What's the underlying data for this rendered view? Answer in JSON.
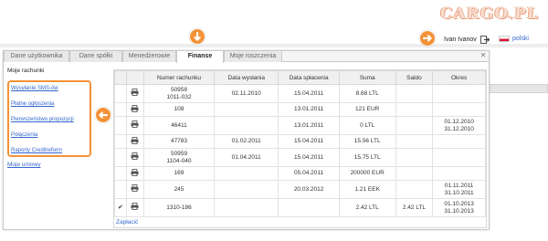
{
  "logo": {
    "text": "CARGO.PL"
  },
  "user": {
    "name": "Ivan Ivanov",
    "logout_icon": "logout-icon"
  },
  "lang": {
    "label": "polski"
  },
  "tabs": [
    {
      "label": "Dane użytkownika",
      "active": false
    },
    {
      "label": "Dane spółki",
      "active": false
    },
    {
      "label": "Menedżerowie",
      "active": false
    },
    {
      "label": "Finanse",
      "active": true
    },
    {
      "label": "Moje roszczenia",
      "active": false
    }
  ],
  "sidebar": {
    "heading": "Moje rachunki",
    "links": [
      {
        "label": "Wysyłanie SMS-ów"
      },
      {
        "label": "Płatne ogłoszenia"
      },
      {
        "label": "Pierwszeństwo propozycji"
      },
      {
        "label": "Połączenia"
      },
      {
        "label": "Raporty Creditreform"
      }
    ],
    "footer": "Moje umowy"
  },
  "table": {
    "columns": [
      "",
      "",
      "Numer rachunku",
      "Data wysłania",
      "Data spłacenia",
      "Suma",
      "Saldo",
      "Okres"
    ],
    "rows": [
      {
        "checked": false,
        "number": "50958",
        "number_sub": "1011-032",
        "sent": "02.11.2010",
        "paid": "15.04.2011",
        "sum": "8.68 LTL",
        "balance": "",
        "period": "",
        "period_sub": ""
      },
      {
        "checked": false,
        "number": "108",
        "number_sub": "",
        "sent": "",
        "paid": "13.01.2011",
        "sum": "121 EUR",
        "balance": "",
        "period": "",
        "period_sub": ""
      },
      {
        "checked": false,
        "number": "46411",
        "number_sub": "",
        "sent": "",
        "paid": "13.01.2011",
        "sum": "0 LTL",
        "balance": "",
        "period": "01.12.2010",
        "period_sub": "31.12.2010"
      },
      {
        "checked": false,
        "number": "47783",
        "number_sub": "",
        "sent": "01.02.2011",
        "paid": "15.04.2011",
        "sum": "15.56 LTL",
        "balance": "",
        "period": "",
        "period_sub": ""
      },
      {
        "checked": false,
        "number": "50959",
        "number_sub": "1104-040",
        "sent": "01.04.2011",
        "paid": "15.04.2011",
        "sum": "15.75 LTL",
        "balance": "",
        "period": "",
        "period_sub": ""
      },
      {
        "checked": false,
        "number": "169",
        "number_sub": "",
        "sent": "",
        "paid": "05.04.2011",
        "sum": "200000 EUR",
        "balance": "",
        "period": "",
        "period_sub": ""
      },
      {
        "checked": false,
        "number": "245",
        "number_sub": "",
        "sent": "",
        "paid": "20.03.2012",
        "sum": "1.21 EEK",
        "balance": "",
        "period": "01.11.2011",
        "period_sub": "31.10.2011"
      },
      {
        "checked": true,
        "number": "1310-186",
        "number_sub": "",
        "sent": "",
        "paid": "",
        "sum": "2.42 LTL",
        "balance": "2.42 LTL",
        "period": "01.10.2013",
        "period_sub": "31.10.2013"
      }
    ],
    "pay_link": "Zapłacić"
  },
  "colors": {
    "accent": "#f39237",
    "link": "#3366cc"
  }
}
